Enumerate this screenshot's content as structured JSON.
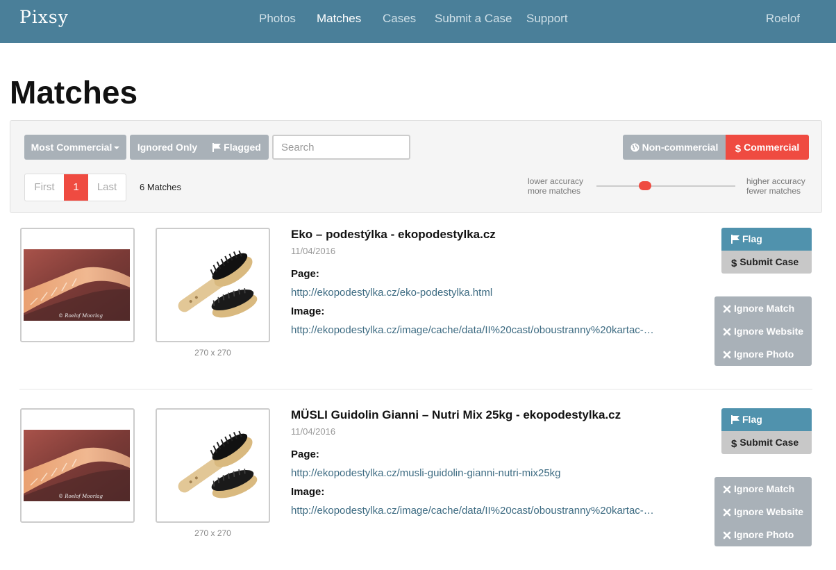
{
  "navbar": {
    "logo": "Pixsy",
    "items": [
      "Photos",
      "Matches",
      "Cases",
      "Submit a Case",
      "Support"
    ],
    "active": "Matches",
    "user": "Roelof"
  },
  "page": {
    "title": "Matches"
  },
  "filters": {
    "sort_label": "Most Commercial",
    "ignored_label": "Ignored Only",
    "flagged_label": "Flagged",
    "search_placeholder": "Search",
    "noncommercial_label": "Non-commercial",
    "commercial_label": "Commercial",
    "pager": {
      "first": "First",
      "current": "1",
      "last": "Last"
    },
    "match_count": "6 Matches",
    "accuracy_low": [
      "lower accuracy",
      "more matches"
    ],
    "accuracy_high": [
      "higher accuracy",
      "fewer matches"
    ],
    "accuracy_level": 0.32
  },
  "colors": {
    "navbar": "#4a7f99",
    "accent_red": "#ef4b41",
    "flag_blue": "#5092ad",
    "button_gray": "#a9b1b8",
    "link": "#3d6b82"
  },
  "matches": [
    {
      "title": "Eko – podestýlka - ekopodestylka.cz",
      "date": "11/04/2016",
      "page_label": "Page:",
      "page_url": "http://ekopodestylka.cz/eko-podestylka.html",
      "image_label": "Image:",
      "image_url": "http://ekopodestylka.cz/image/cache/data/II%20cast/oboustranny%20kartac-…",
      "dimensions": "270 x 270",
      "watermark": "© Roelof Moorlag",
      "actions": {
        "flag": "Flag",
        "submit": "Submit Case",
        "ignore_match": "Ignore Match",
        "ignore_website": "Ignore Website",
        "ignore_photo": "Ignore Photo"
      }
    },
    {
      "title": "MÜSLI Guidolin Gianni – Nutri Mix 25kg - ekopodestylka.cz",
      "date": "11/04/2016",
      "page_label": "Page:",
      "page_url": "http://ekopodestylka.cz/musli-guidolin-gianni-nutri-mix25kg",
      "image_label": "Image:",
      "image_url": "http://ekopodestylka.cz/image/cache/data/II%20cast/oboustranny%20kartac-…",
      "dimensions": "270 x 270",
      "watermark": "© Roelof Moorlag",
      "actions": {
        "flag": "Flag",
        "submit": "Submit Case",
        "ignore_match": "Ignore Match",
        "ignore_website": "Ignore Website",
        "ignore_photo": "Ignore Photo"
      }
    }
  ]
}
